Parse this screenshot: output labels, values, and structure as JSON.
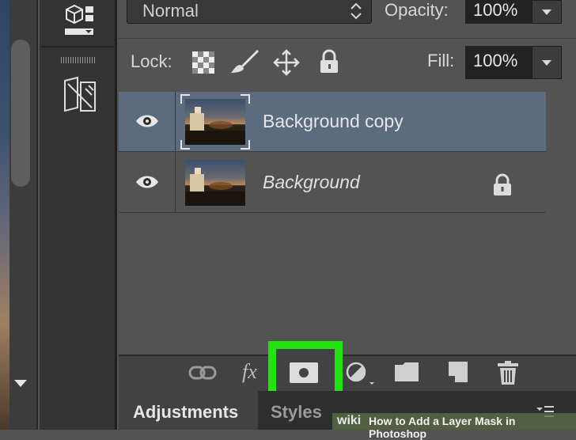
{
  "layers_panel": {
    "blend_mode": "Normal",
    "opacity_label": "Opacity:",
    "opacity_value": "100%",
    "lock_label": "Lock:",
    "fill_label": "Fill:",
    "fill_value": "100%",
    "layers": [
      {
        "name": "Background copy",
        "visible": true,
        "selected": true,
        "locked": false,
        "italic": false
      },
      {
        "name": "Background",
        "visible": true,
        "selected": false,
        "locked": true,
        "italic": true
      }
    ]
  },
  "bottom_toolbar": {
    "icons": [
      "link-icon",
      "fx-icon",
      "add-layer-mask-icon",
      "adjustment-layer-icon",
      "folder-icon",
      "new-layer-icon",
      "trash-icon"
    ],
    "fx_label": "fx",
    "highlighted": "add-layer-mask-icon",
    "highlight_color": "#22e20f"
  },
  "tabs": [
    {
      "label": "Adjustments",
      "active": true
    },
    {
      "label": "Styles",
      "active": false
    }
  ],
  "watermark": {
    "logo": "wiki",
    "text": "How to Add a Layer Mask in Photoshop"
  },
  "colors": {
    "panel_bg": "#535353",
    "selected_row": "#5c6b7e",
    "toolbar_bg": "#424242"
  }
}
